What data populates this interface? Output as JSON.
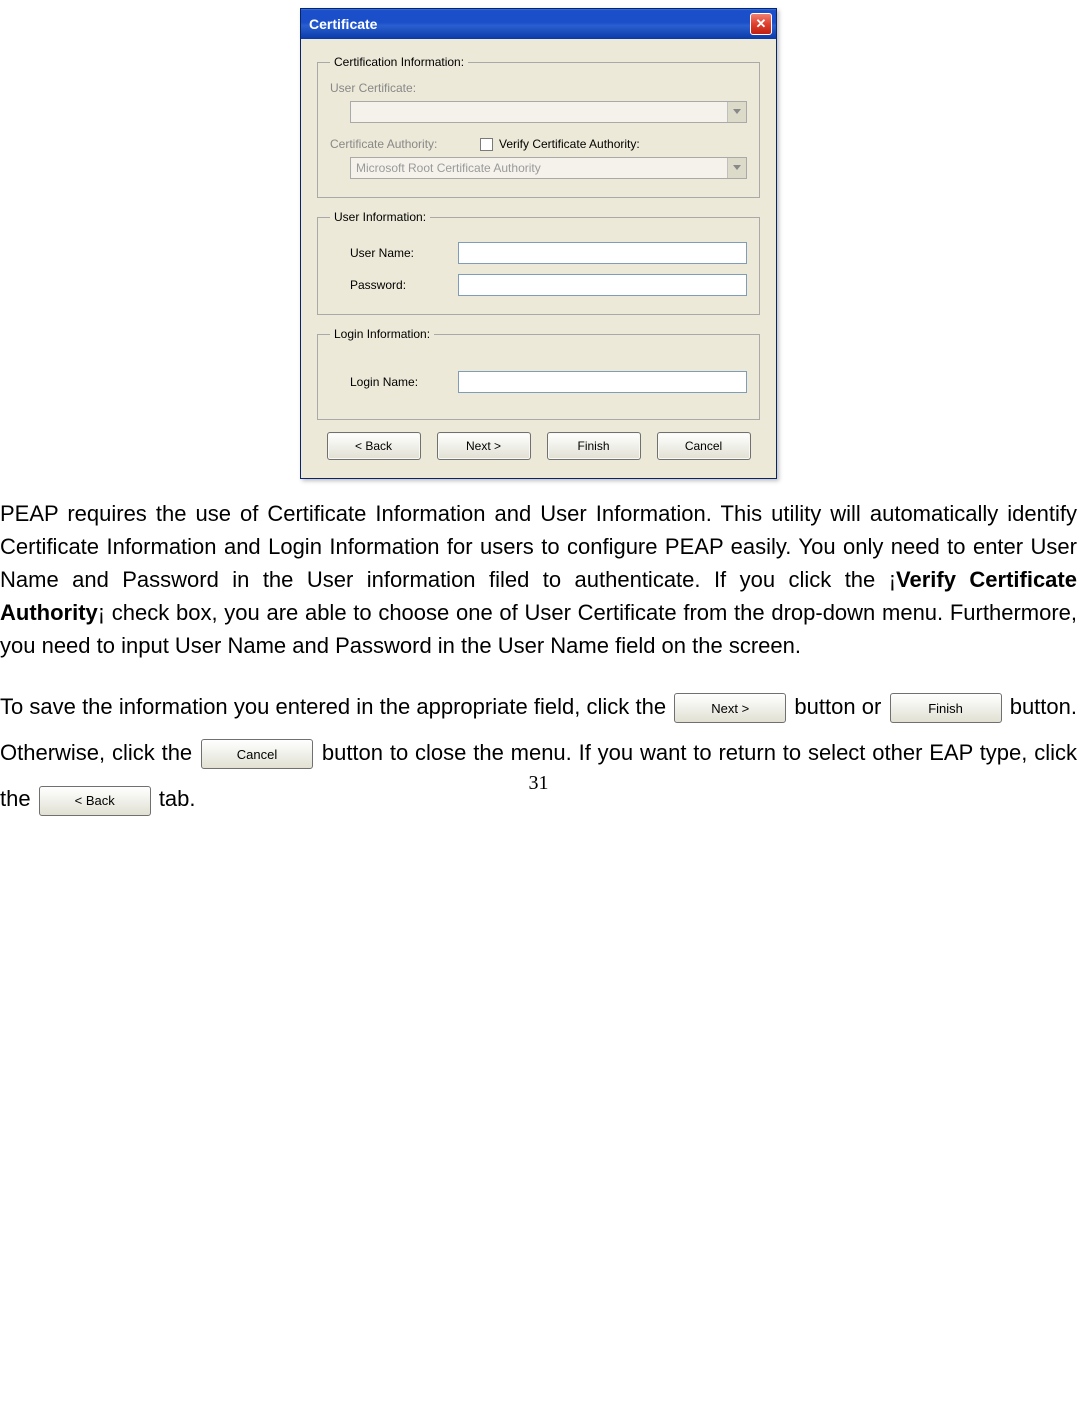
{
  "dialog": {
    "title": "Certificate",
    "groups": {
      "certInfo": {
        "legend": "Certification Information:",
        "userCertLabel": "User Certificate:",
        "userCertValue": "",
        "certAuthLabel": "Certificate Authority:",
        "verifyLabel": "Verify Certificate Authority:",
        "certAuthValue": "Microsoft Root Certificate Authority"
      },
      "userInfo": {
        "legend": "User Information:",
        "userNameLabel": "User Name:",
        "passwordLabel": "Password:"
      },
      "loginInfo": {
        "legend": "Login Information:",
        "loginNameLabel": "Login Name:"
      }
    },
    "buttons": {
      "back": "< Back",
      "next": "Next >",
      "finish": "Finish",
      "cancel": "Cancel"
    }
  },
  "body": {
    "p1a": "PEAP requires the use of Certificate Information and User Information. This utility will automatically identify Certificate Information and Login Information for users to configure PEAP easily. You only need to enter User Name and Password in the User information filed to authenticate. If you click the ¡",
    "p1bold": "Verify Certificate Authority",
    "p1b": "¡ check box, you are able to choose one of User Certificate from the drop-down menu. Furthermore, you need to input User Name and Password in the User Name field on the screen.",
    "p2a": "To save the information you entered in the appropriate field, click the ",
    "p2b": " button or ",
    "p2c": " button. Otherwise, click the ",
    "p2d": " button to close the menu. If you want to return to select other EAP type, click the ",
    "p2e": " tab."
  },
  "inlineButtons": {
    "next": "Next >",
    "finish": "Finish",
    "cancel": "Cancel",
    "back": "< Back"
  },
  "pageNumber": "31"
}
